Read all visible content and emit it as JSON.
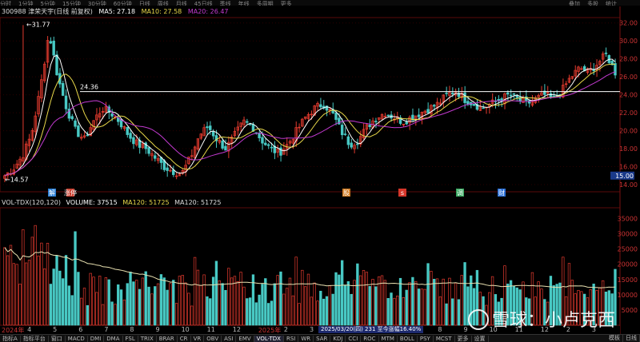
{
  "topbar": {
    "items": [
      "分时",
      "1分钟",
      "5分钟",
      "15分钟",
      "30分钟",
      "60分钟",
      "日线",
      "周线",
      "月线",
      "45日线",
      "季线",
      "年线",
      "多周期",
      "更多"
    ],
    "right_items": [
      "叠加",
      "多股",
      "统计"
    ]
  },
  "stock": {
    "code_name": "300988 津荣天宇(日线 前复权)",
    "ma5": "MA5: 27.18",
    "ma10": "MA10: 27.58",
    "ma20": "MA20: 26.47"
  },
  "volume_header": {
    "name": "VOL-TDX(120,120)",
    "volume": "VOLUME: 37515",
    "ma120a": "MA120: 51725",
    "ma120b": "MA120: 51725"
  },
  "annotations": {
    "high": "31.77",
    "low": "14.57",
    "resistance": "24.36",
    "current_price_tag": "15.00"
  },
  "event_markers": [
    {
      "label": "解",
      "color": "#2b7fd6"
    },
    {
      "label": "涨停",
      "color": "#c83a2a"
    },
    {
      "label": "股",
      "color": "#d07a20"
    },
    {
      "label": "s",
      "color": "#d6362a"
    },
    {
      "label": "调",
      "color": "#3aa860"
    },
    {
      "label": "财",
      "color": "#2b6fd6"
    }
  ],
  "date_labels": [
    {
      "text": "2024年",
      "color": "#c33"
    },
    {
      "text": "4"
    },
    {
      "text": "5"
    },
    {
      "text": "6"
    },
    {
      "text": "7"
    },
    {
      "text": "8"
    },
    {
      "text": "9"
    },
    {
      "text": "10"
    },
    {
      "text": "11"
    },
    {
      "text": "12"
    },
    {
      "text": "2025年",
      "color": "#c33"
    },
    {
      "text": "2"
    },
    {
      "text": "3"
    },
    {
      "text": "4"
    },
    {
      "text": "5"
    },
    {
      "text": "6"
    },
    {
      "text": "7"
    },
    {
      "text": "8"
    },
    {
      "text": "9"
    },
    {
      "text": "10"
    },
    {
      "text": "11"
    },
    {
      "text": "12"
    },
    {
      "text": "2"
    },
    {
      "text": "3"
    }
  ],
  "range_info": "2025/03/20(四) 231 至今涨幅16.40%",
  "tabs": [
    "指标A",
    "指标平台",
    "窗口",
    "MACD",
    "DMI",
    "DMA",
    "FSL",
    "TRIX",
    "BRAR",
    "CR",
    "VR",
    "OBV",
    "ASI",
    "EMV",
    "VOL-TDX",
    "RSI",
    "WR",
    "SAR",
    "KDJ",
    "CCI",
    "ROC",
    "MTM",
    "BOLL",
    "PSY",
    "MCST",
    "更多",
    "设置"
  ],
  "active_tab": "VOL-TDX",
  "right_tabs": [
    "日线",
    "模板"
  ],
  "watermark": "雪球：小卢克西",
  "colors": {
    "up": "#e23a2e",
    "down": "#48c9c4",
    "ma5": "#ffffff",
    "ma10": "#e8d84a",
    "ma20": "#c23ad0",
    "volma": "#e8e0b0",
    "grid": "#2a0000"
  },
  "chart_data": [
    {
      "type": "candlestick",
      "title": "",
      "y_axis_ticks": [
        14.0,
        16.0,
        18.0,
        20.0,
        22.0,
        24.0,
        26.0,
        28.0,
        30.0,
        32.0
      ],
      "ylim": [
        13.2,
        32.6
      ],
      "series": [
        {
          "name": "MA5",
          "value": 27.18
        },
        {
          "name": "MA10",
          "value": 27.58
        },
        {
          "name": "MA20",
          "value": 26.47
        }
      ],
      "key_points": {
        "high": 31.77,
        "low": 14.57,
        "resistance_line": 24.36
      },
      "approx_close_path": [
        15.0,
        15.8,
        17.2,
        19.5,
        24.5,
        31.0,
        26.0,
        22.5,
        20.0,
        19.0,
        21.0,
        22.5,
        22.0,
        21.0,
        19.5,
        18.5,
        18.0,
        17.0,
        16.0,
        15.5,
        15.2,
        17.0,
        19.5,
        20.5,
        19.0,
        18.0,
        19.5,
        21.0,
        20.5,
        19.0,
        18.0,
        17.5,
        18.5,
        20.0,
        21.5,
        22.5,
        23.0,
        22.0,
        20.0,
        18.5,
        19.0,
        20.5,
        21.5,
        22.0,
        21.5,
        21.0,
        21.5,
        22.0,
        22.5,
        23.0,
        24.0,
        24.5,
        23.5,
        23.0,
        22.5,
        23.0,
        23.5,
        24.0,
        23.5,
        23.0,
        23.5,
        24.0,
        23.5,
        24.5,
        26.0,
        27.0,
        26.5,
        27.5,
        28.5,
        26.5
      ],
      "volume": {
        "y_axis_ticks": [
          5000,
          10000,
          15000,
          20000,
          25000,
          30000,
          35000
        ],
        "ylim": [
          0,
          38000
        ],
        "current_volume": 37515,
        "ma120": 51725
      }
    }
  ]
}
